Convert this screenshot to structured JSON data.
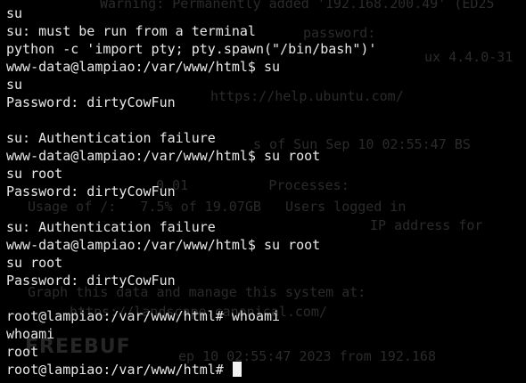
{
  "terminal": {
    "lines": [
      "su",
      "su: must be run from a terminal",
      "python -c 'import pty; pty.spawn(\"/bin/bash\")'",
      "www-data@lampiao:/var/www/html$ su",
      "su",
      "Password: dirtyCowFun",
      "",
      "su: Authentication failure",
      "www-data@lampiao:/var/www/html$ su root",
      "su root",
      "Password: dirtyCowFun",
      "",
      "su: Authentication failure",
      "www-data@lampiao:/var/www/html$ su root",
      "su root",
      "Password: dirtyCowFun",
      "",
      "root@lampiao:/var/www/html# whoami",
      "whoami",
      "root"
    ],
    "prompt": "root@lampiao:/var/www/html# ",
    "ghost_lines": [
      "Warning: Permanently added '192.168.200.49' (ED25",
      "password:",
      "ux 4.4.0-31",
      "https://help.ubuntu.com/",
      "s of Sun Sep 10 02:55:47 BS",
      "0.01          Processes:",
      "Usage of /:   7.5% of 19.07GB   Users logged in",
      "IP address for",
      "Graph this data and manage this system at:",
      "https://landscape.canonical.com/",
      "ep 10 02:55:47 2023 from 192.168"
    ],
    "watermark": "FREEBUF"
  }
}
